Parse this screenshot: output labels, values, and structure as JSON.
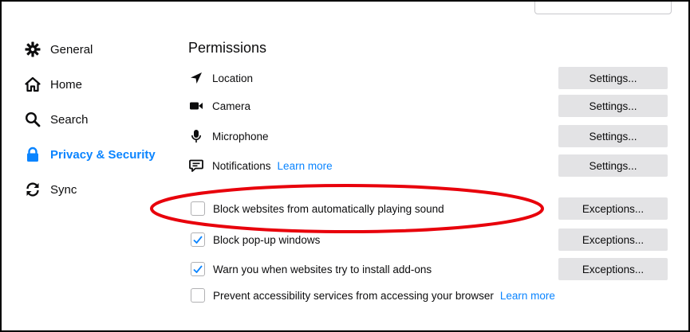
{
  "sidebar": {
    "items": [
      {
        "label": "General",
        "icon": "gear-icon",
        "selected": false
      },
      {
        "label": "Home",
        "icon": "home-icon",
        "selected": false
      },
      {
        "label": "Search",
        "icon": "search-icon",
        "selected": false
      },
      {
        "label": "Privacy & Security",
        "icon": "lock-icon",
        "selected": true
      },
      {
        "label": "Sync",
        "icon": "sync-icon",
        "selected": false
      }
    ]
  },
  "permissions": {
    "title": "Permissions",
    "rows": [
      {
        "label": "Location",
        "icon": "location-arrow-icon",
        "button": "Settings..."
      },
      {
        "label": "Camera",
        "icon": "camera-icon",
        "button": "Settings..."
      },
      {
        "label": "Microphone",
        "icon": "microphone-icon",
        "button": "Settings..."
      },
      {
        "label": "Notifications",
        "icon": "notification-icon",
        "button": "Settings...",
        "link": "Learn more"
      }
    ],
    "checkboxes": [
      {
        "label": "Block websites from automatically playing sound",
        "checked": false,
        "button": "Exceptions..."
      },
      {
        "label": "Block pop-up windows",
        "checked": true,
        "button": "Exceptions..."
      },
      {
        "label": "Warn you when websites try to install add-ons",
        "checked": true,
        "button": "Exceptions..."
      },
      {
        "label": "Prevent accessibility services from accessing your browser",
        "checked": false,
        "link": "Learn more"
      }
    ]
  },
  "colors": {
    "accent": "#0a84ff",
    "button_bg": "#e3e3e5",
    "annotation": "#e8000b"
  }
}
